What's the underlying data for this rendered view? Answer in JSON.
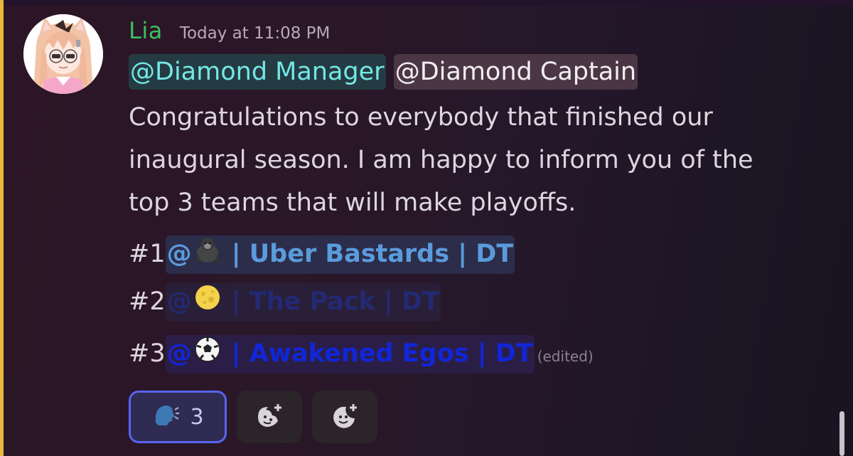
{
  "message": {
    "author": "Lia",
    "timestamp": "Today at 11:08 PM",
    "mentions": {
      "manager": "@Diamond Manager",
      "captain": "@Diamond Captain"
    },
    "body_lines": [
      "Congratulations to everybody that finished our",
      "inaugural season. I am happy to inform you of the",
      "top 3 teams that will make playoffs."
    ],
    "rankings": [
      {
        "rank": "#1",
        "at": "@",
        "emoji": "gorilla",
        "role": " | Uber Bastards | DT"
      },
      {
        "rank": "#2",
        "at": "@",
        "emoji": "full-moon",
        "role": " | The Pack | DT"
      },
      {
        "rank": "#3",
        "at": "@",
        "emoji": "soccer-ball",
        "role": " | Awakened Egos | DT"
      }
    ],
    "edited": "(edited)"
  },
  "reactions": [
    {
      "emoji": "speaking-head",
      "count": "3",
      "active": true
    },
    {
      "icon": "add-super-reaction-icon"
    },
    {
      "icon": "add-reaction-icon"
    }
  ],
  "colors": {
    "username": "#3fbd62",
    "highlight_bar": "#e8b73c",
    "manager_mention": "#75e6e4",
    "role_uber": "#5a9bdc",
    "role_pack": "#232a73",
    "role_egos": "#1126d8",
    "reaction_border": "#5865f2"
  }
}
